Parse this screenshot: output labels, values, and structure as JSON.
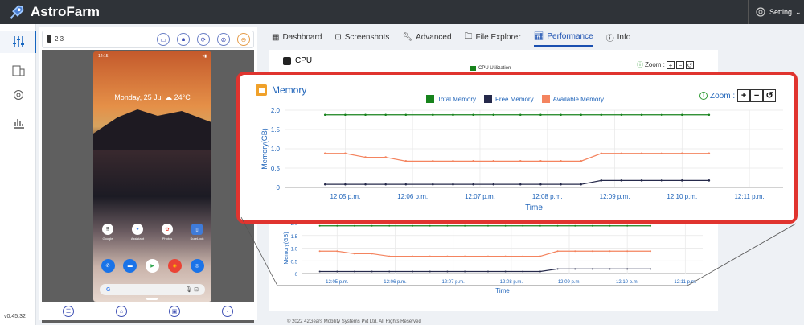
{
  "app": {
    "name": "AstroFarm",
    "version": "v0.45.32",
    "setting_label": "Setting"
  },
  "sidebar": {
    "items": [
      {
        "icon": "sliders-icon"
      },
      {
        "icon": "devices-icon"
      },
      {
        "icon": "gear-icon"
      },
      {
        "icon": "bar-chart-icon"
      }
    ]
  },
  "device": {
    "label": "2.3",
    "status_time": "12:15",
    "date_text": "Monday, 25 Jul ☁ 24°C",
    "apps_row1": [
      {
        "label": "Google"
      },
      {
        "label": "Assistant"
      },
      {
        "label": "Photos"
      },
      {
        "label": "SureLock"
      }
    ],
    "search_placeholder": "G"
  },
  "tabs": [
    {
      "label": "Dashboard",
      "icon": "dashboard-icon"
    },
    {
      "label": "Screenshots",
      "icon": "screenshot-icon"
    },
    {
      "label": "Advanced",
      "icon": "wrench-icon"
    },
    {
      "label": "File Explorer",
      "icon": "folder-icon"
    },
    {
      "label": "Performance",
      "icon": "performance-icon",
      "active": true
    },
    {
      "label": "Info",
      "icon": "info-icon"
    }
  ],
  "cpu_card": {
    "title": "CPU",
    "legend_label": "CPU Utilization",
    "zoom_label": "Zoom :"
  },
  "footer": {
    "text": "© 2022 42Gears Mobility Systems Pvt Ltd. All Rights Reserved"
  },
  "memory_popup": {
    "title": "Memory",
    "zoom_label": "Zoom :",
    "zoom_in": "+",
    "zoom_out": "−",
    "zoom_reset": "↺"
  },
  "chart_data": {
    "type": "line",
    "title": "Memory",
    "xlabel": "Time",
    "ylabel": "Memory(GB)",
    "ylim": [
      0,
      2.0
    ],
    "yticks": [
      "0",
      "0.5",
      "1.0",
      "1.5",
      "2.0"
    ],
    "xticks": [
      "12:05 p.m.",
      "12:06 p.m.",
      "12:07 p.m.",
      "12:08 p.m.",
      "12:09 p.m.",
      "12:10 p.m.",
      "12:11 p.m."
    ],
    "xtick_minutes": [
      5,
      6,
      7,
      8,
      9,
      10,
      11
    ],
    "x_minutes": [
      4.7,
      5.0,
      5.3,
      5.6,
      5.9,
      6.3,
      6.6,
      6.9,
      7.2,
      7.6,
      7.9,
      8.2,
      8.5,
      8.8,
      9.1,
      9.4,
      9.7,
      10.0,
      10.4
    ],
    "legend_position": "top-center",
    "grid": true,
    "series": [
      {
        "name": "Total Memory",
        "color": "#17831c",
        "values": [
          1.88,
          1.88,
          1.88,
          1.88,
          1.88,
          1.88,
          1.88,
          1.88,
          1.88,
          1.88,
          1.88,
          1.88,
          1.88,
          1.88,
          1.88,
          1.88,
          1.88,
          1.88,
          1.88
        ]
      },
      {
        "name": "Free Memory",
        "color": "#25294a",
        "values": [
          0.08,
          0.08,
          0.08,
          0.08,
          0.08,
          0.08,
          0.08,
          0.08,
          0.08,
          0.08,
          0.08,
          0.08,
          0.08,
          0.18,
          0.18,
          0.18,
          0.18,
          0.18,
          0.18
        ]
      },
      {
        "name": "Available Memory",
        "color": "#f4845f",
        "values": [
          0.88,
          0.88,
          0.78,
          0.78,
          0.68,
          0.68,
          0.68,
          0.68,
          0.68,
          0.68,
          0.68,
          0.68,
          0.68,
          0.88,
          0.88,
          0.88,
          0.88,
          0.88,
          0.88
        ]
      }
    ]
  }
}
